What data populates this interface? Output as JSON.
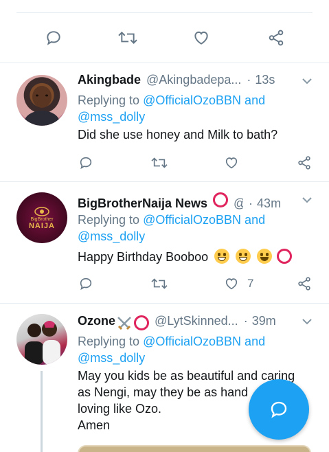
{
  "tweets": [
    {
      "name": "Akingbade",
      "handle": "@Akingbadepa...",
      "dot": "·",
      "time": "13s",
      "replying_prefix": "Replying to",
      "replying_mentions": "@OfficialOzoBBN and",
      "replying_mentions2": "@mss_dolly",
      "text": "Did she use honey and Milk to bath?"
    },
    {
      "name": "BigBrotherNaija News",
      "handle": "@",
      "dot": "·",
      "time": "43m",
      "replying_prefix": "Replying to",
      "replying_mentions": "@OfficialOzoBBN and",
      "replying_mentions2": "@mss_dolly",
      "text": "Happy Birthday Booboo",
      "like_count": "7",
      "avatar_text": "NAIJA",
      "avatar_small_text": "BigBrother"
    },
    {
      "name": "Ozone",
      "handle": "@LytSkinned...",
      "dot": "·",
      "time": "39m",
      "replying_prefix": "Replying to",
      "replying_mentions": "@OfficialOzoBBN and",
      "replying_mentions2": "@mss_dolly",
      "text_lines": [
        "May you kids be as beautiful and caring",
        "as Nengi, may they be as hand",
        "loving like Ozo.",
        "Amen"
      ],
      "text_line2_tail": "d"
    }
  ],
  "colors": {
    "link": "#1da1f2",
    "muted": "#657786",
    "red_ring": "#e0245e",
    "fab": "#1da1f2"
  },
  "icons": [
    "reply-icon",
    "retweet-icon",
    "like-icon",
    "share-icon",
    "chevron-down-icon",
    "compose-reply-icon"
  ]
}
